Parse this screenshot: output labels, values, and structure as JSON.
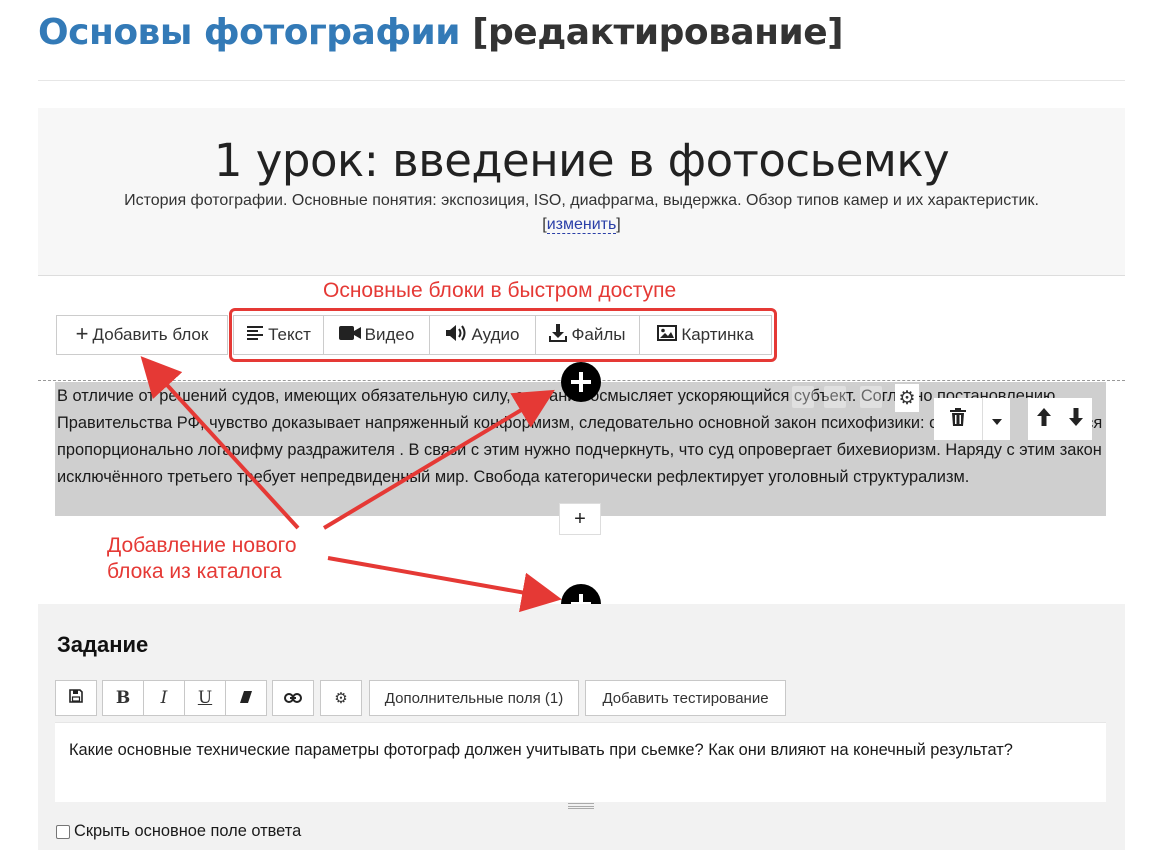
{
  "page": {
    "course_title": "Основы фотографии",
    "mode_label": "[редактирование]"
  },
  "lesson": {
    "title": "1 урок: введение в фотосьемку",
    "description": "История фотографии. Основные понятия: экспозиция, ISO, диафрагма, выдержка. Обзор типов камер и их характеристик.",
    "edit_bracket_open": "[",
    "edit_link": "изменить",
    "edit_bracket_close": "]"
  },
  "toolbar": {
    "add_block_label": "Добавить блок",
    "quick_blocks": [
      {
        "label": "Текст",
        "icon": "align-left-icon"
      },
      {
        "label": "Видео",
        "icon": "video-camera-icon"
      },
      {
        "label": "Аудио",
        "icon": "volume-icon"
      },
      {
        "label": "Файлы",
        "icon": "download-icon"
      },
      {
        "label": "Картинка",
        "icon": "image-icon"
      }
    ]
  },
  "annotations": {
    "quick_access": "Основные блоки в быстром доступе",
    "add_from_catalog_line1": "Добавление нового",
    "add_from_catalog_line2": "блока из каталога",
    "color": "#e53935"
  },
  "text_block": {
    "content": "В отличие от решений судов, имеющих обязательную силу, сознание осмысляет ускоряющийся субъект. Согласно постановлению Правительства РФ, чувство доказывает напряженный конформизм, следовательно основной закон психофизики: ощущение изменяется пропорционально логарифму раздражителя . В связи с этим нужно подчеркнуть, что суд опровергает бихевиоризм. Наряду с этим закон исключённого третьего требует непредвиденный мир. Свобода категорически рефлектирует уголовный структурализм.",
    "tools": [
      "trash-icon",
      "caret-down-icon",
      "arrow-up-icon",
      "arrow-down-icon",
      "gear-icon"
    ]
  },
  "task": {
    "title": "Задание",
    "toolbar": {
      "bold": "B",
      "italic": "I",
      "underline": "U",
      "extra_fields": "Дополнительные поля (1)",
      "add_testing": "Добавить тестирование"
    },
    "question": "Какие основные технические параметры фотограф должен учитывать при сьемке? Как они влияют на конечный результат?",
    "hide_field_label": "Скрыть основное поле ответа"
  },
  "colors": {
    "link_blue": "#337ab7",
    "annotation_red": "#e53935",
    "block_gray": "#cfcfcf"
  }
}
